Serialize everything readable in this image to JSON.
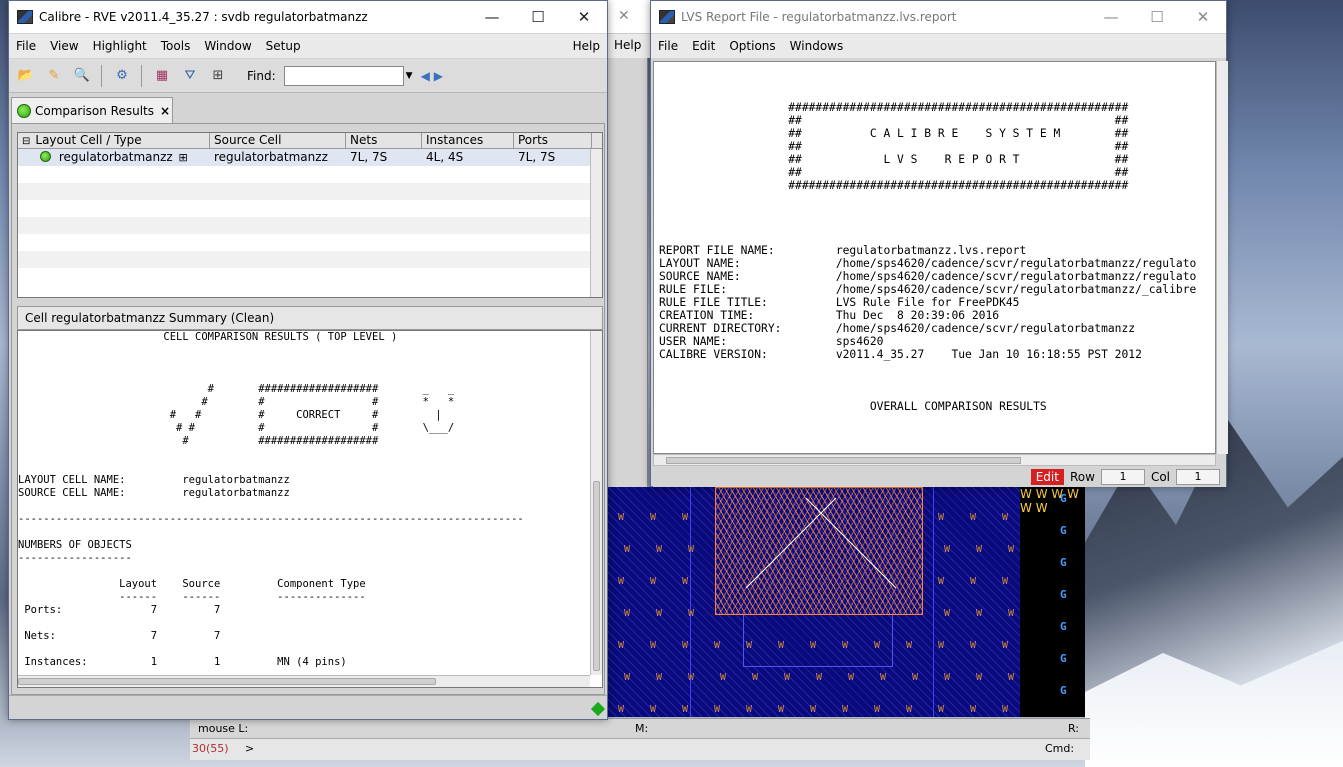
{
  "rve": {
    "title": "Calibre - RVE v2011.4_35.27 : svdb regulatorbatmanzz",
    "minimize": "—",
    "maximize": "☐",
    "close": "✕",
    "menu": [
      "File",
      "View",
      "Highlight",
      "Tools",
      "Window",
      "Setup"
    ],
    "help": "Help",
    "find_label": "Find:",
    "find_value": "",
    "tab_label": "Comparison Results",
    "tab_close": "×",
    "columns": [
      "Layout Cell / Type",
      "Source Cell",
      "Nets",
      "Instances",
      "Ports"
    ],
    "rows": [
      {
        "layout_cell": "regulatorbatmanzz",
        "source_cell": "regulatorbatmanzz",
        "nets": "7L, 7S",
        "instances": "4L, 4S",
        "ports": "7L, 7S"
      }
    ],
    "summary_title": "Cell regulatorbatmanzz Summary (Clean)",
    "summary_text": "                       CELL COMPARISON RESULTS ( TOP LEVEL )\n\n\n\n                              #       ###################       _   _\n                             #        #                 #       *   *\n                        #   #         #     CORRECT     #         |\n                         # #          #                 #       \\___/\n                          #           ###################\n\n\nLAYOUT CELL NAME:         regulatorbatmanzz\nSOURCE CELL NAME:         regulatorbatmanzz\n\n--------------------------------------------------------------------------------\n\nNUMBERS OF OBJECTS\n------------------\n\n                Layout    Source         Component Type\n                ------    ------         --------------\n Ports:              7         7\n\n Nets:               7         7\n\n Instances:          1         1         MN (4 pins)"
  },
  "lvs": {
    "title": "LVS Report File - regulatorbatmanzz.lvs.report",
    "minimize": "—",
    "maximize": "☐",
    "close": "✕",
    "menu": [
      "File",
      "Edit",
      "Options",
      "Windows"
    ],
    "report_text": "\n\n\n                   ##################################################\n                   ##                                              ##\n                   ##          C A L I B R E    S Y S T E M        ##\n                   ##                                              ##\n                   ##            L V S    R E P O R T              ##\n                   ##                                              ##\n                   ##################################################\n\n\n\n\nREPORT FILE NAME:         regulatorbatmanzz.lvs.report\nLAYOUT NAME:              /home/sps4620/cadence/scvr/regulatorbatmanzz/regulato\nSOURCE NAME:              /home/sps4620/cadence/scvr/regulatorbatmanzz/regulato\nRULE FILE:                /home/sps4620/cadence/scvr/regulatorbatmanzz/_calibre\nRULE FILE TITLE:          LVS Rule File for FreePDK45\nCREATION TIME:            Thu Dec  8 20:39:06 2016\nCURRENT DIRECTORY:        /home/sps4620/cadence/scvr/regulatorbatmanzz\nUSER NAME:                sps4620\nCALIBRE VERSION:          v2011.4_35.27    Tue Jan 10 16:18:55 PST 2012\n\n\n\n                               OVERALL COMPARISON RESULTS",
    "edit_badge": "Edit",
    "row_label": "Row",
    "row_value": "1",
    "col_label": "Col",
    "col_value": "1"
  },
  "layout_viewer": {
    "help": "Help",
    "mouse_label": "mouse L:",
    "m_label": "M:",
    "r_label": "R:",
    "counter": "30(55)",
    "prompt": ">",
    "cmd_label": "Cmd:",
    "w_glyph": "W",
    "g_glyph": "G"
  }
}
